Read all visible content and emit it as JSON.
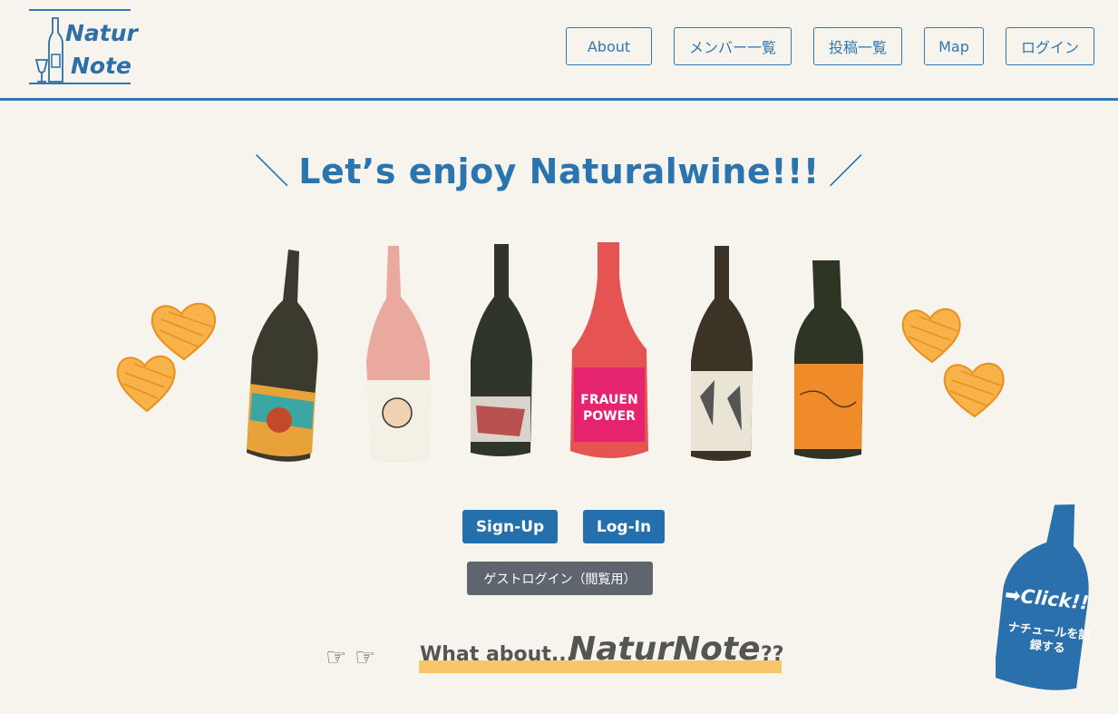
{
  "logo": {
    "line1": "Natur",
    "line2": "Note"
  },
  "nav": [
    {
      "label": "About"
    },
    {
      "label": "メンバー一覧"
    },
    {
      "label": "投稿一覧"
    },
    {
      "label": "Map"
    },
    {
      "label": "ログイン"
    }
  ],
  "hero": {
    "title": "Let’s enjoy Naturalwine!!!",
    "slash_left": "＼",
    "slash_right": "／"
  },
  "bottles": [
    {
      "label_color": "#e8a23a",
      "glass_color": "#3a3a2e"
    },
    {
      "label_color": "#f5f0e6",
      "glass_color": "#e9a196"
    },
    {
      "label_color": "#d9d3cc",
      "glass_color": "#2f3528"
    },
    {
      "label_color": "#e6246e",
      "glass_color": "#e44a4a"
    },
    {
      "label_color": "#e9e4d6",
      "glass_color": "#3b3426"
    },
    {
      "label_color": "#f08b2a",
      "glass_color": "#2f3525"
    }
  ],
  "buttons": {
    "signup": "Sign-Up",
    "login": "Log-In",
    "guest": "ゲストログイン（閲覧用）"
  },
  "what_about": {
    "prefix": "What about...",
    "brand": "NaturNote",
    "suffix": "??"
  },
  "click_bottle": {
    "line1": "➡Click!!",
    "line2": "ナチュールを記録する"
  },
  "colors": {
    "accent": "#2a74b0",
    "background": "#f6f4ec",
    "heart": "#f5a03a",
    "guest_button": "#5f656d"
  }
}
